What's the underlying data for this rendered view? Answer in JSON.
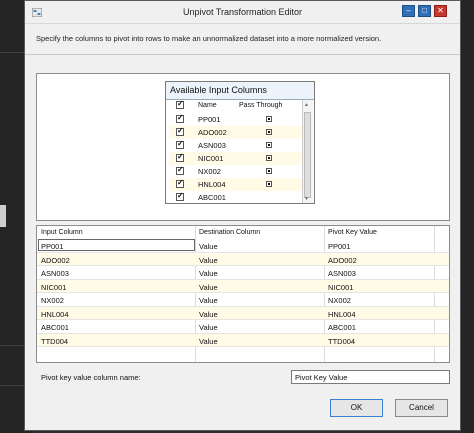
{
  "window": {
    "title": "Unpivot Transformation Editor",
    "description": "Specify the columns to pivot into rows to make an unnormalized dataset into a more normalized version.",
    "minimize_label": "–",
    "maximize_label": "□",
    "close_label": "✕"
  },
  "available_columns": {
    "title": "Available Input Columns",
    "header_name": "Name",
    "header_pass": "Pass Through",
    "items": [
      {
        "name": "PP001"
      },
      {
        "name": "ADO002"
      },
      {
        "name": "ASN003"
      },
      {
        "name": "NIC001"
      },
      {
        "name": "NX002"
      },
      {
        "name": "HNL004"
      },
      {
        "name": "ABC001"
      }
    ]
  },
  "mapping": {
    "headers": {
      "input": "Input Column",
      "destination": "Destination Column",
      "pivot": "Pivot Key Value"
    },
    "rows": [
      {
        "input": "PP001",
        "destination": "Value",
        "pivot": "PP001"
      },
      {
        "input": "ADO002",
        "destination": "Value",
        "pivot": "ADO002"
      },
      {
        "input": "ASN003",
        "destination": "Value",
        "pivot": "ASN003"
      },
      {
        "input": "NIC001",
        "destination": "Value",
        "pivot": "NIC001"
      },
      {
        "input": "NX002",
        "destination": "Value",
        "pivot": "NX002"
      },
      {
        "input": "HNL004",
        "destination": "Value",
        "pivot": "HNL004"
      },
      {
        "input": "ABC001",
        "destination": "Value",
        "pivot": "ABC001"
      },
      {
        "input": "TTD004",
        "destination": "Value",
        "pivot": "TTD004"
      }
    ]
  },
  "pivot_key": {
    "label": "Pivot key value column name:",
    "value": "Pivot Key Value"
  },
  "buttons": {
    "ok": "OK",
    "cancel": "Cancel"
  }
}
